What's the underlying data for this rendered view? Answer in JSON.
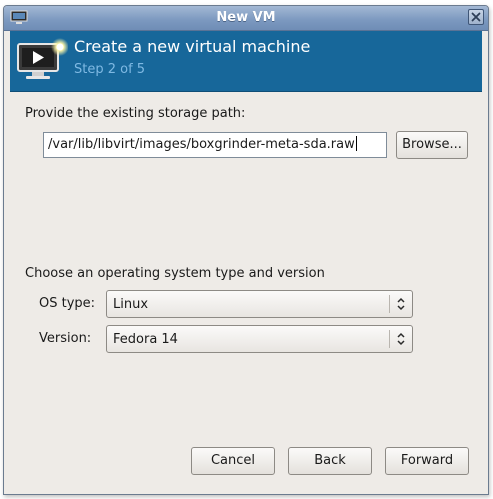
{
  "window": {
    "title": "New VM"
  },
  "header": {
    "title": "Create a new virtual machine",
    "step": "Step 2 of 5"
  },
  "storage": {
    "label": "Provide the existing storage path:",
    "path_value": "/var/lib/libvirt/images/boxgrinder-meta-sda.raw",
    "browse_label": "Browse..."
  },
  "os": {
    "section_label": "Choose an operating system type and version",
    "type_label": "OS type:",
    "type_value": "Linux",
    "version_label": "Version:",
    "version_value": "Fedora 14"
  },
  "buttons": {
    "cancel": "Cancel",
    "back": "Back",
    "forward": "Forward"
  },
  "icons": {
    "title": "vm-manager-icon",
    "header": "monitor-play-icon",
    "close": "close-icon",
    "combo": "up-down-arrows-icon"
  },
  "colors": {
    "header_bg": "#17679a",
    "step_text": "#7fb9e3",
    "window_bg": "#eeebe7"
  }
}
